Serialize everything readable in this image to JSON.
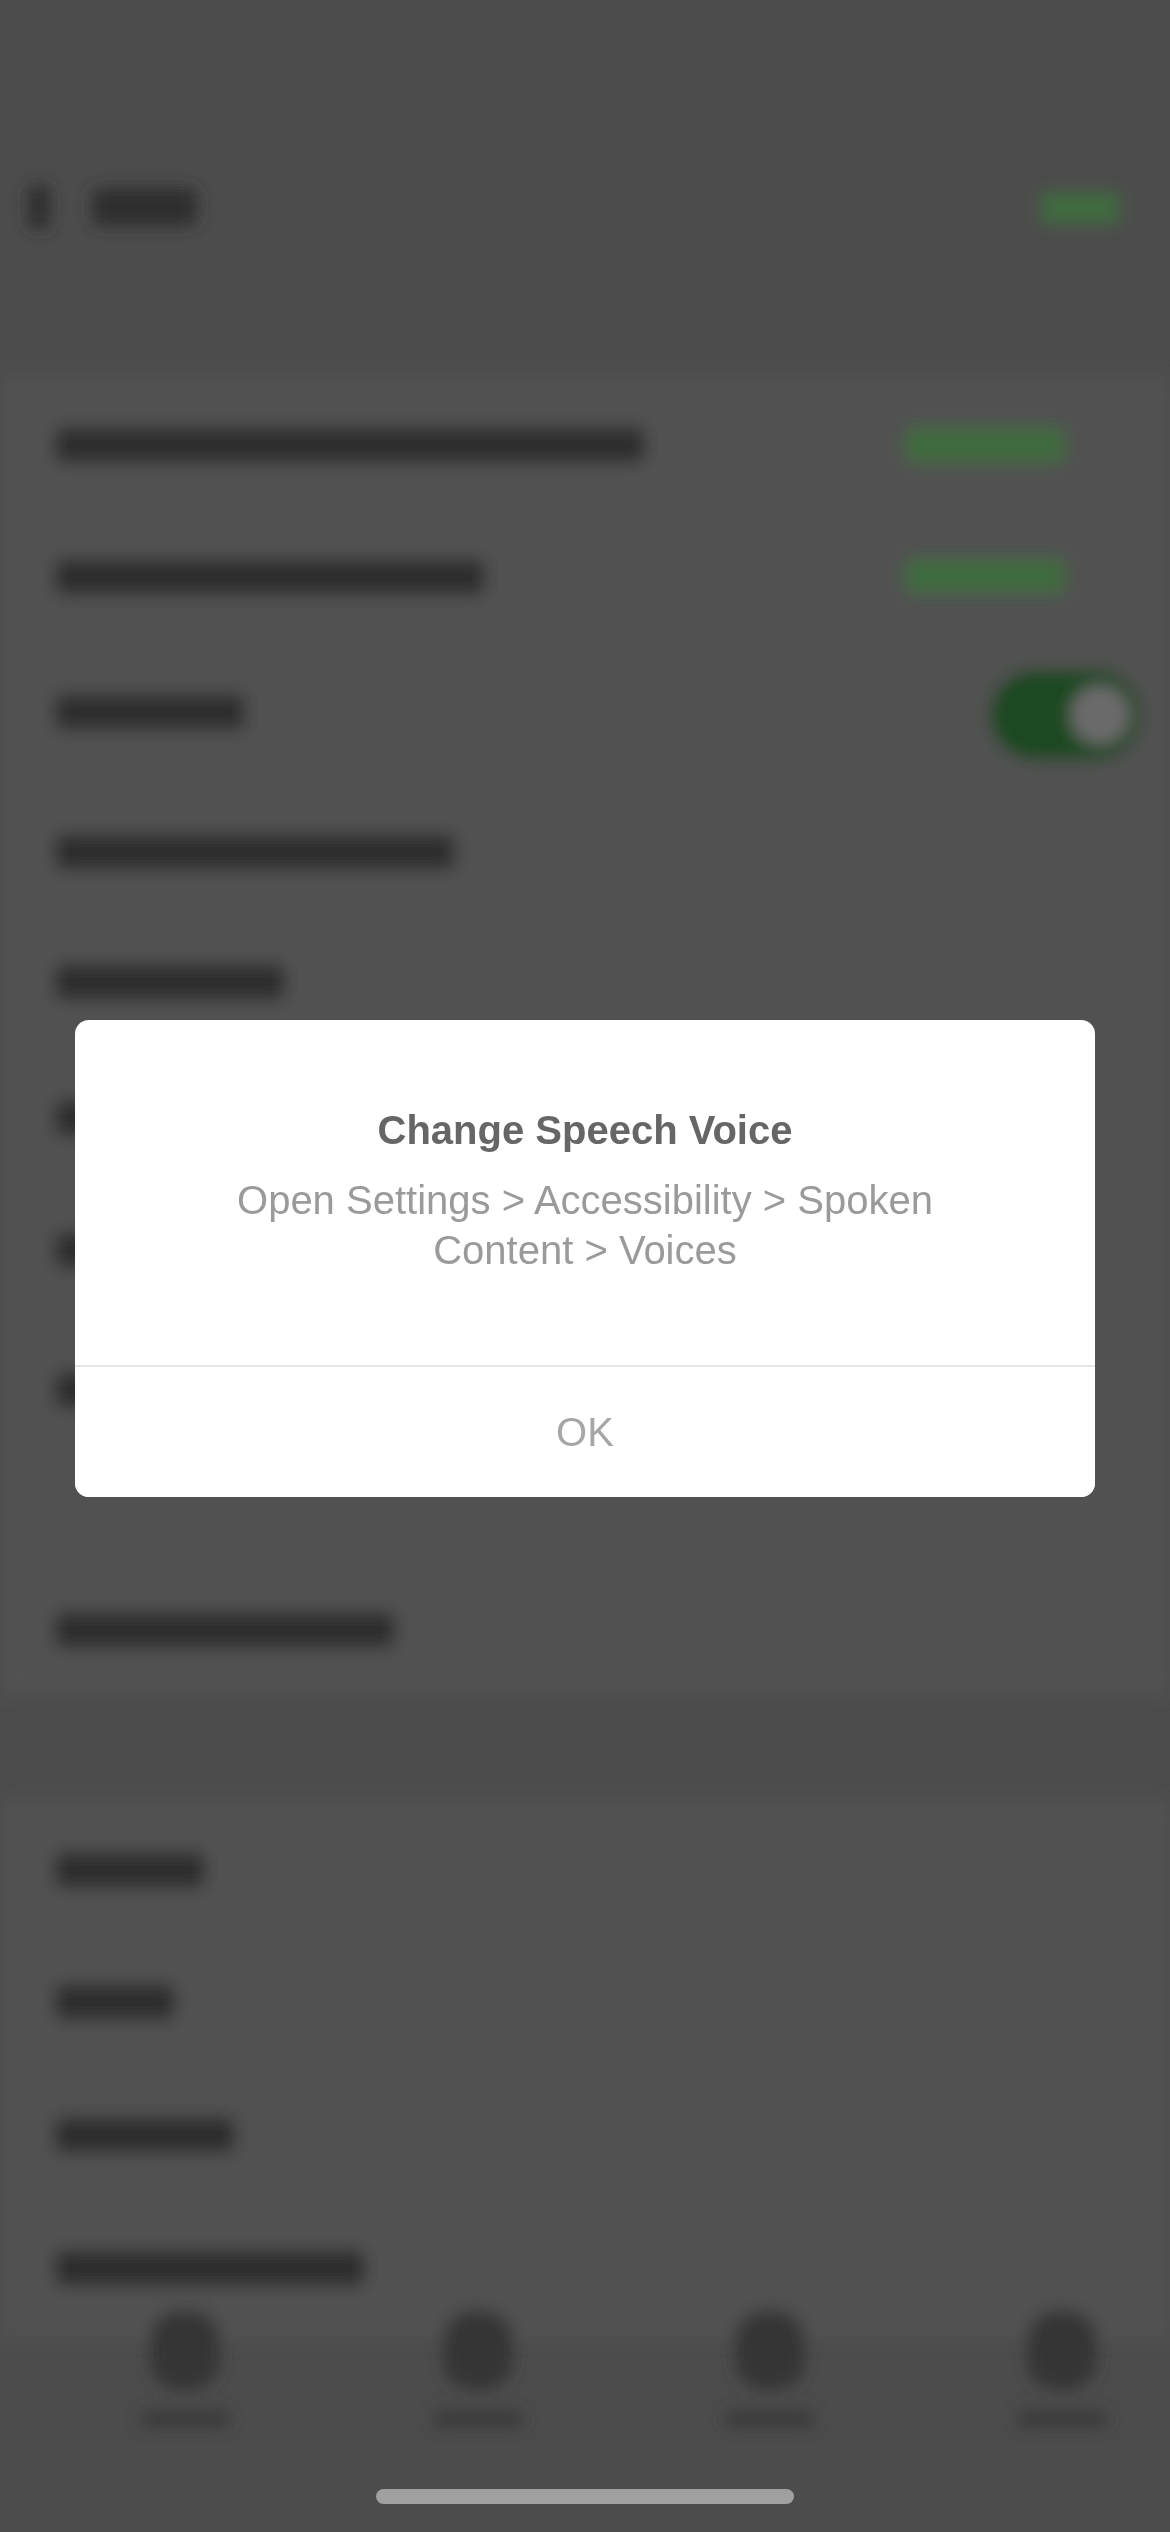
{
  "dialog": {
    "title": "Change Speech Voice",
    "message": "Open Settings > Accessibility > Spoken Content > Voices",
    "buttons": [
      "OK"
    ]
  }
}
